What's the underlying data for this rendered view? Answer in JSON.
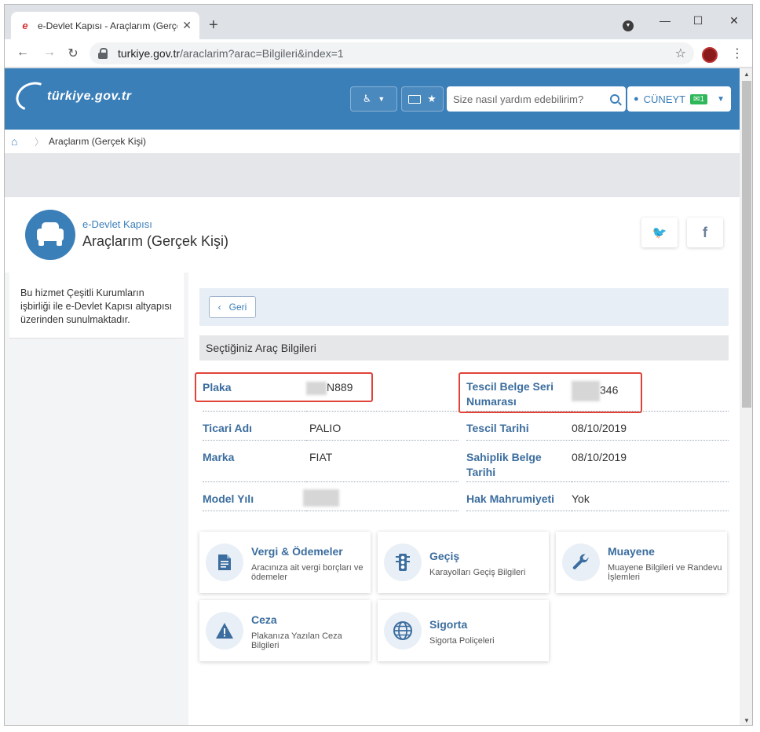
{
  "browser": {
    "tab_title": "e-Devlet Kapısı - Araçlarım (Gerçe",
    "tab_favicon": "e",
    "new_tab": "+",
    "url_host": "turkiye.gov.tr",
    "url_rest": "/araclarim?arac=Bilgileri&index=1"
  },
  "header": {
    "logo_text": "türkiye.gov.tr",
    "search_placeholder": "Size nasıl yardım edebilirim?",
    "user_name": "CÜNEYT",
    "mail_badge": "1"
  },
  "breadcrumb": {
    "current": "Araçlarım (Gerçek Kişi)"
  },
  "page_head": {
    "subtitle": "e-Devlet Kapısı",
    "title": "Araçlarım (Gerçek Kişi)",
    "twitter": "🐦",
    "facebook": "f"
  },
  "sidebar": {
    "note": "Bu hizmet Çeşitli Kurumların işbirliği ile e-Devlet Kapısı altyapısı üzerinden sunulmaktadır."
  },
  "main": {
    "back_label": "Geri",
    "section_title": "Seçtiğiniz Araç Bilgileri",
    "fields": {
      "plaka_label": "Plaka",
      "plaka_value": "N889",
      "tescil_seri_label_1": "Tescil Belge Seri",
      "tescil_seri_label_2": "Numarası",
      "tescil_seri_value": "346",
      "ticari_adi_label": "Ticari Adı",
      "ticari_adi_value": "PALIO",
      "tescil_tarihi_label": "Tescil Tarihi",
      "tescil_tarihi_value": "08/10/2019",
      "marka_label": "Marka",
      "marka_value": "FIAT",
      "sahiplik_label_1": "Sahiplik Belge",
      "sahiplik_label_2": "Tarihi",
      "sahiplik_value": "08/10/2019",
      "model_yili_label": "Model Yılı",
      "hak_label": "Hak Mahrumiyeti",
      "hak_value": "Yok"
    },
    "cards": [
      {
        "title": "Vergi & Ödemeler",
        "desc": "Aracınıza ait vergi borçları ve ödemeler",
        "icon": "document-icon"
      },
      {
        "title": "Geçiş",
        "desc": "Karayolları Geçiş Bilgileri",
        "icon": "traffic-light-icon"
      },
      {
        "title": "Muayene",
        "desc": "Muayene Bilgileri ve Randevu İşlemleri",
        "icon": "wrench-icon"
      },
      {
        "title": "Ceza",
        "desc": "Plakanıza Yazılan Ceza Bilgileri",
        "icon": "warning-icon"
      },
      {
        "title": "Sigorta",
        "desc": "Sigorta Poliçeleri",
        "icon": "globe-icon"
      }
    ]
  },
  "colors": {
    "brand": "#3b7fb9",
    "label": "#3b6d9e",
    "highlight": "#e04338"
  }
}
